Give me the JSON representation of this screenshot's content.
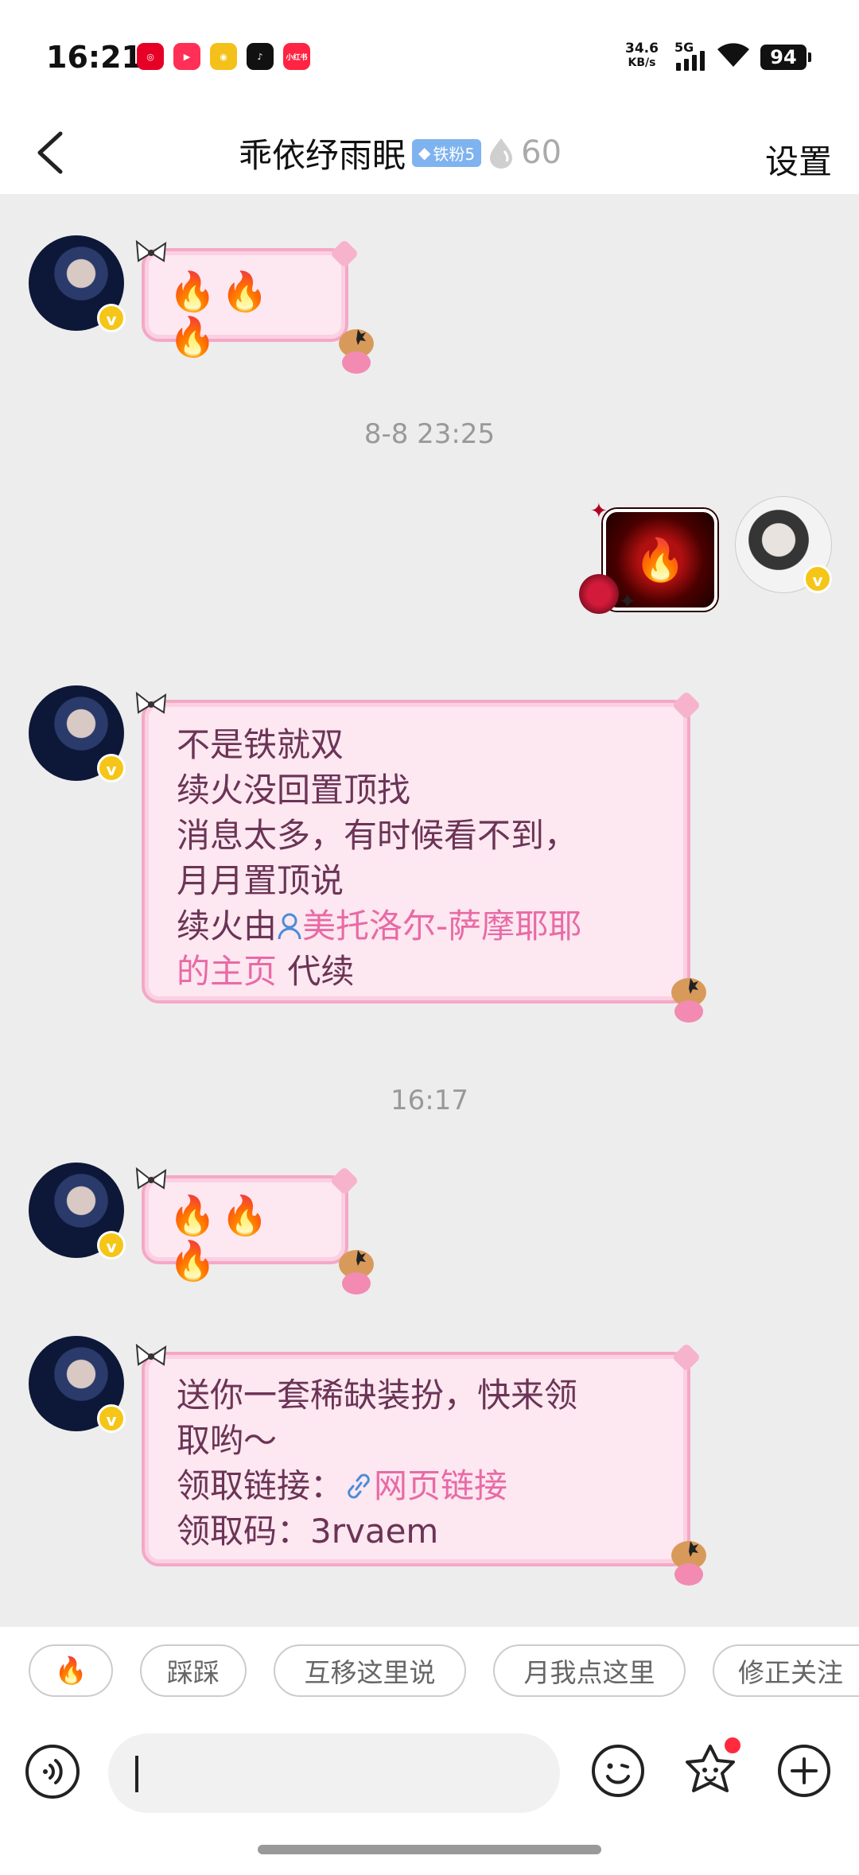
{
  "status_bar": {
    "time": "16:21",
    "app_icons": [
      {
        "name": "netease-music-icon",
        "color": "#e60026",
        "glyph": "◎"
      },
      {
        "name": "video-app-icon",
        "color": "#ff2f55",
        "glyph": "▶"
      },
      {
        "name": "weibo-icon",
        "color": "#f4c11a",
        "glyph": "◉"
      },
      {
        "name": "tiktok-icon",
        "color": "#111111",
        "glyph": "♪"
      },
      {
        "name": "xiaohongshu-icon",
        "color": "#ff2442",
        "glyph": "小红书"
      }
    ],
    "net_speed_value": "34.6",
    "net_speed_unit": "KB/s",
    "signal_type": "5G",
    "battery": "94"
  },
  "header": {
    "title": "乖依纾雨眠",
    "badge": "铁粉5",
    "streak_count": "60",
    "settings_label": "设置"
  },
  "messages": [
    {
      "side": "left",
      "type": "text",
      "text": "🔥🔥🔥"
    },
    {
      "type": "timestamp",
      "text": "8-8 23:25"
    },
    {
      "side": "right",
      "type": "sticker",
      "text": "🔥"
    },
    {
      "side": "left",
      "type": "text",
      "lines": [
        "不是铁就双",
        "续火没回置顶找",
        "消息太多，有时候看不到，",
        "月月置顶说"
      ],
      "line5_prefix": "续火由",
      "mention": "美托洛尔-萨摩耶耶",
      "mention_cont": "的主页",
      "line6_suffix": " 代续"
    },
    {
      "type": "timestamp",
      "text": "16:17"
    },
    {
      "side": "left",
      "type": "text",
      "text": "🔥🔥🔥"
    },
    {
      "side": "left",
      "type": "text",
      "lines": [
        "送你一套稀缺装扮，快来领",
        "取哟～"
      ],
      "link_prefix": "领取链接：",
      "link_text": "网页链接",
      "code_line": "领取码：3rvaem"
    }
  ],
  "quick_replies": [
    "🔥",
    "踩踩",
    "互移这里说",
    "月我点这里",
    "修正关注"
  ],
  "input": {
    "placeholder": ""
  }
}
